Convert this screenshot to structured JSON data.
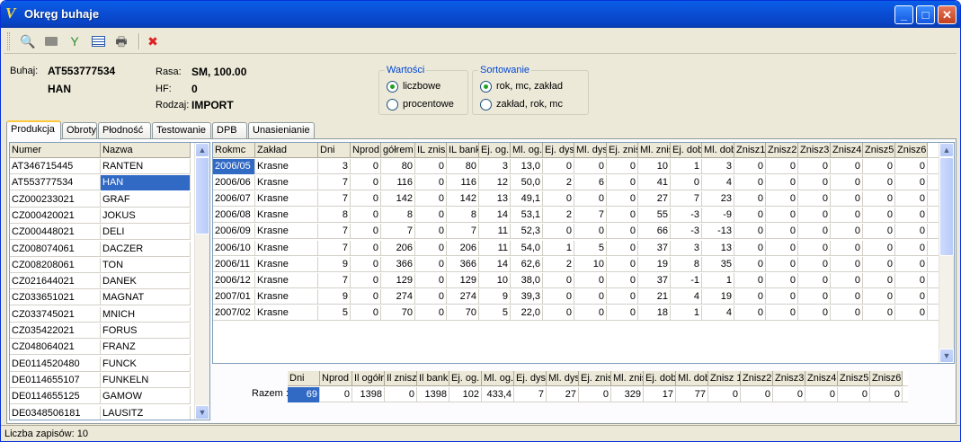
{
  "window": {
    "title": "Okręg buhaje",
    "app_icon": "V"
  },
  "toolbar": {
    "icons": [
      "search-icon",
      "blank-icon",
      "filter-icon",
      "list-icon",
      "print-icon",
      "close-doc-icon"
    ]
  },
  "info": {
    "buhaj_label": "Buhaj:",
    "buhaj_code": "AT553777534",
    "buhaj_name": "HAN",
    "rasa_label": "Rasa:",
    "rasa_value": "SM, 100.00",
    "hf_label": "HF:",
    "hf_value": "0",
    "rodzaj_label": "Rodzaj:",
    "rodzaj_value": "IMPORT"
  },
  "wartosci": {
    "title": "Wartości",
    "opt1": "liczbowe",
    "opt2": "procentowe",
    "selected": "liczbowe"
  },
  "sortowanie": {
    "title": "Sortowanie",
    "opt1": "rok, mc, zakład",
    "opt2": "zakład, rok, mc",
    "selected": "rok, mc, zakład"
  },
  "tabs": [
    "Produkcja",
    "Obroty",
    "Płodność",
    "Testowanie",
    "DPB",
    "Unasienianie"
  ],
  "bull_list": {
    "headers": [
      "Numer",
      "Nazwa"
    ],
    "rows": [
      [
        "AT346715445",
        "RANTEN"
      ],
      [
        "AT553777534",
        "HAN"
      ],
      [
        "CZ000233021",
        "GRAF"
      ],
      [
        "CZ000420021",
        "JOKUS"
      ],
      [
        "CZ000448021",
        "DELI"
      ],
      [
        "CZ008074061",
        "DACZER"
      ],
      [
        "CZ008208061",
        "TON"
      ],
      [
        "CZ021644021",
        "DANEK"
      ],
      [
        "CZ033651021",
        "MAGNAT"
      ],
      [
        "CZ033745021",
        "MNICH"
      ],
      [
        "CZ035422021",
        "FORUS"
      ],
      [
        "CZ048064021",
        "FRANZ"
      ],
      [
        "DE0114520480",
        "FUNCK"
      ],
      [
        "DE0114655107",
        "FUNKELN"
      ],
      [
        "DE0114655125",
        "GAMOW"
      ],
      [
        "DE0348506181",
        "LAUSITZ"
      ]
    ],
    "selected_row": 1
  },
  "main_grid": {
    "headers": [
      "Rokmc",
      "Zakład",
      "Dni",
      "Nprod",
      "gółrem",
      "IL znisz",
      "IL bank",
      "Ej. og.",
      "Ml. og.",
      "Ej. dys",
      "Ml. dys",
      "Ej. znis",
      "Ml. znis",
      "Ej. dob",
      "Ml. dob",
      "Znisz1",
      "Znisz2",
      "Znisz3",
      "Znisz4",
      "Znisz5",
      "Znisz6"
    ],
    "rows": [
      [
        "2006/05",
        "Krasne",
        "3",
        "0",
        "80",
        "0",
        "80",
        "3",
        "13,0",
        "0",
        "0",
        "0",
        "10",
        "1",
        "3",
        "0",
        "0",
        "0",
        "0",
        "0",
        "0"
      ],
      [
        "2006/06",
        "Krasne",
        "7",
        "0",
        "116",
        "0",
        "116",
        "12",
        "50,0",
        "2",
        "6",
        "0",
        "41",
        "0",
        "4",
        "0",
        "0",
        "0",
        "0",
        "0",
        "0"
      ],
      [
        "2006/07",
        "Krasne",
        "7",
        "0",
        "142",
        "0",
        "142",
        "13",
        "49,1",
        "0",
        "0",
        "0",
        "27",
        "7",
        "23",
        "0",
        "0",
        "0",
        "0",
        "0",
        "0"
      ],
      [
        "2006/08",
        "Krasne",
        "8",
        "0",
        "8",
        "0",
        "8",
        "14",
        "53,1",
        "2",
        "7",
        "0",
        "55",
        "-3",
        "-9",
        "0",
        "0",
        "0",
        "0",
        "0",
        "0"
      ],
      [
        "2006/09",
        "Krasne",
        "7",
        "0",
        "7",
        "0",
        "7",
        "11",
        "52,3",
        "0",
        "0",
        "0",
        "66",
        "-3",
        "-13",
        "0",
        "0",
        "0",
        "0",
        "0",
        "0"
      ],
      [
        "2006/10",
        "Krasne",
        "7",
        "0",
        "206",
        "0",
        "206",
        "11",
        "54,0",
        "1",
        "5",
        "0",
        "37",
        "3",
        "13",
        "0",
        "0",
        "0",
        "0",
        "0",
        "0"
      ],
      [
        "2006/11",
        "Krasne",
        "9",
        "0",
        "366",
        "0",
        "366",
        "14",
        "62,6",
        "2",
        "10",
        "0",
        "19",
        "8",
        "35",
        "0",
        "0",
        "0",
        "0",
        "0",
        "0"
      ],
      [
        "2006/12",
        "Krasne",
        "7",
        "0",
        "129",
        "0",
        "129",
        "10",
        "38,0",
        "0",
        "0",
        "0",
        "37",
        "-1",
        "1",
        "0",
        "0",
        "0",
        "0",
        "0",
        "0"
      ],
      [
        "2007/01",
        "Krasne",
        "9",
        "0",
        "274",
        "0",
        "274",
        "9",
        "39,3",
        "0",
        "0",
        "0",
        "21",
        "4",
        "19",
        "0",
        "0",
        "0",
        "0",
        "0",
        "0"
      ],
      [
        "2007/02",
        "Krasne",
        "5",
        "0",
        "70",
        "0",
        "70",
        "5",
        "22,0",
        "0",
        "0",
        "0",
        "18",
        "1",
        "4",
        "0",
        "0",
        "0",
        "0",
        "0",
        "0"
      ]
    ]
  },
  "totals": {
    "label": "Razem :",
    "headers": [
      "Dni",
      "Nprod",
      "Il ogółr",
      "Il znisz",
      "Il bank",
      "Ej. og.",
      "Ml. og.",
      "Ej. dys",
      "Ml. dys",
      "Ej. znis",
      "Ml. znis",
      "Ej. dob",
      "Ml. dob",
      "Znisz 1",
      "Znisz2",
      "Znisz3",
      "Znisz4",
      "Znisz5",
      "Znisz6"
    ],
    "values": [
      "69",
      "0",
      "1398",
      "0",
      "1398",
      "102",
      "433,4",
      "7",
      "27",
      "0",
      "329",
      "17",
      "77",
      "0",
      "0",
      "0",
      "0",
      "0",
      "0"
    ]
  },
  "status": {
    "text": "Liczba zapisów: 10"
  }
}
